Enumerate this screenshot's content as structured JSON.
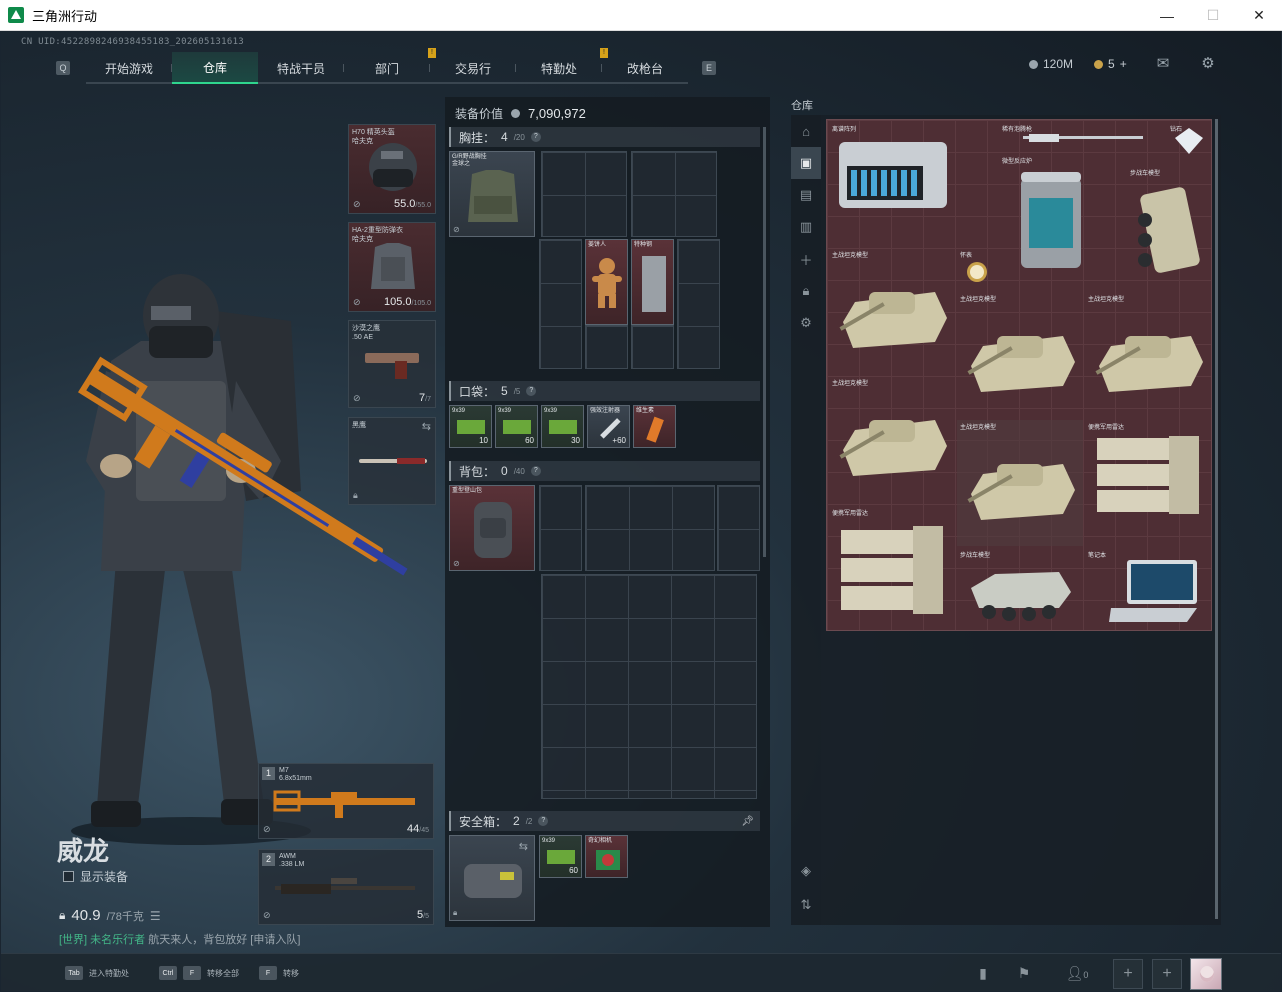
{
  "window": {
    "title": "三角洲行动",
    "minimize": "—",
    "maximize": "☐",
    "close": "✕"
  },
  "uid": "CN UID:4522898246938455183_202605131613",
  "nav": {
    "left_key": "Q",
    "right_key": "E",
    "tabs": [
      {
        "label": "开始游戏"
      },
      {
        "label": "仓库",
        "active": true
      },
      {
        "label": "特战干员"
      },
      {
        "label": "部门"
      },
      {
        "label": "交易行"
      },
      {
        "label": "特勤处"
      },
      {
        "label": "改枪台"
      }
    ]
  },
  "currency": {
    "primary": "120M",
    "secondary": "5",
    "add": "+"
  },
  "character": {
    "name": "威龙",
    "show_equipment": "显示装备",
    "weight": "40.9",
    "weight_max": "/78千克",
    "chat_channel": "[世界] 未名乐行者",
    "chat_message": "航天来人，背包放好",
    "chat_link": "[申请入队]"
  },
  "gear": {
    "helmet": {
      "name": "H70 精英头盔",
      "sub": "哈夫克",
      "value": "55.0",
      "max": "/55.0"
    },
    "armor": {
      "name": "HA-2重型防弹衣",
      "sub": "哈夫克",
      "value": "105.0",
      "max": "/105.0"
    },
    "pistol": {
      "name": "沙漠之鹰",
      "sub": ".50 AE",
      "value": "7",
      "max": "/7"
    },
    "melee": {
      "name": "黑鹰"
    }
  },
  "weapons": [
    {
      "num": "1",
      "name": "M7",
      "caliber": "6.8x51mm",
      "ammo": "44",
      "max": "/45"
    },
    {
      "num": "2",
      "name": "AWM",
      "caliber": ".338 LM",
      "ammo": "5",
      "max": "/5"
    }
  ],
  "equipment": {
    "value_label": "装备价值",
    "value": "7,090,972",
    "chest_rig": {
      "label": "胸挂：",
      "count": "4",
      "max": "/20",
      "item": "G/R野战胸挂",
      "item_sub": "金球之",
      "items": [
        {
          "name": "姜饼人"
        },
        {
          "name": "特种钢"
        }
      ]
    },
    "pocket": {
      "label": "口袋：",
      "count": "5",
      "max": "/5",
      "items": [
        {
          "name": "9x39",
          "count": "10"
        },
        {
          "name": "9x39",
          "count": "60"
        },
        {
          "name": "9x39",
          "count": "30"
        },
        {
          "name": "强效注射器",
          "count": "+60"
        },
        {
          "name": "维生素"
        }
      ]
    },
    "backpack": {
      "label": "背包：",
      "count": "0",
      "max": "/40",
      "item": "重型登山包"
    },
    "safebox": {
      "label": "安全箱：",
      "count": "2",
      "max": "/2",
      "items": [
        {
          "name": "9x39",
          "count": "60"
        },
        {
          "name": "奇幻相机"
        }
      ]
    }
  },
  "warehouse": {
    "label": "仓库",
    "items": [
      {
        "name": "离谱阵列"
      },
      {
        "name": "稀有泡腾枪"
      },
      {
        "name": "钻石"
      },
      {
        "name": "微型反应炉"
      },
      {
        "name": "步战车模型"
      },
      {
        "name": "怀表"
      },
      {
        "name": "主战坦克模型"
      },
      {
        "name": "主战坦克模型"
      },
      {
        "name": "主战坦克模型"
      },
      {
        "name": "主战坦克模型"
      },
      {
        "name": "主战坦克模型"
      },
      {
        "name": "便携军用雷达"
      },
      {
        "name": "便携军用雷达"
      },
      {
        "name": "步战车模型"
      },
      {
        "name": "笔记本"
      }
    ]
  },
  "bottom": {
    "hints": [
      {
        "key": "Tab",
        "label": "进入特勤处"
      },
      {
        "key": "Ctrl",
        "key2": "F",
        "label": "转移全部"
      },
      {
        "key": "F",
        "label": "转移"
      }
    ],
    "friends_count": "0"
  }
}
